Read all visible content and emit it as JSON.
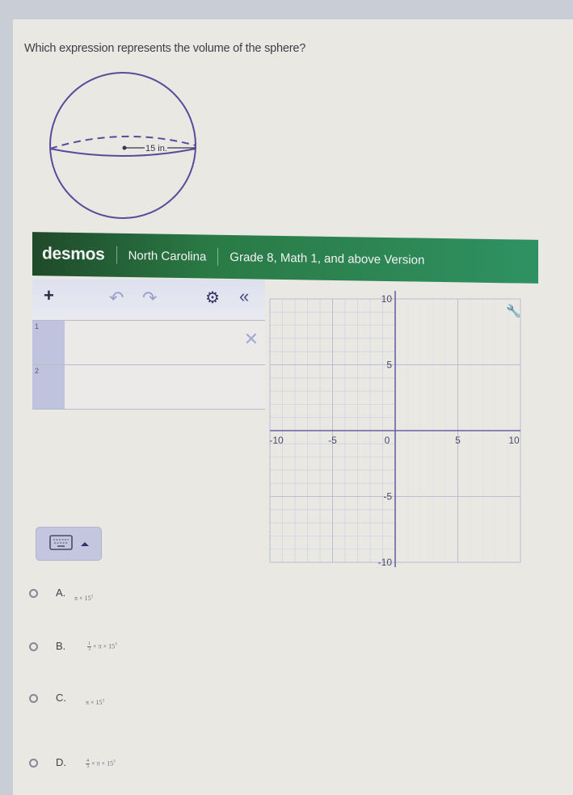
{
  "question": "Which expression represents the volume of the sphere?",
  "figure": {
    "label": "15 in."
  },
  "desmos": {
    "logo": "desmos",
    "region": "North Carolina",
    "version": "Grade 8, Math 1, and above Version",
    "toolbar": {
      "add": "+",
      "undo": "↶",
      "redo": "↷",
      "settings": "⚙",
      "collapse": "«"
    },
    "expressions": [
      {
        "index": "1",
        "value": ""
      },
      {
        "index": "2",
        "value": ""
      }
    ],
    "delete_icon": "✕",
    "graph": {
      "x_ticks": [
        "-10",
        "-5",
        "0",
        "5",
        "10"
      ],
      "y_ticks": [
        "10",
        "5",
        "-5",
        "-10"
      ],
      "x_range": [
        -10,
        10
      ],
      "y_range": [
        -10,
        10
      ]
    },
    "wrench_icon": "wrench"
  },
  "options": [
    {
      "letter": "A.",
      "expr": {
        "pre": "",
        "frac_num": "",
        "frac_den": "",
        "body": "π × 15",
        "exp": "2"
      }
    },
    {
      "letter": "B.",
      "expr": {
        "pre": "",
        "frac_num": "1",
        "frac_den": "3",
        "body": " × π × 15",
        "exp": "3"
      }
    },
    {
      "letter": "C.",
      "expr": {
        "pre": "",
        "frac_num": "",
        "frac_den": "",
        "body": "π × 15",
        "exp": "3"
      }
    },
    {
      "letter": "D.",
      "expr": {
        "pre": "",
        "frac_num": "4",
        "frac_den": "3",
        "body": " × π × 15",
        "exp": "3"
      }
    }
  ]
}
